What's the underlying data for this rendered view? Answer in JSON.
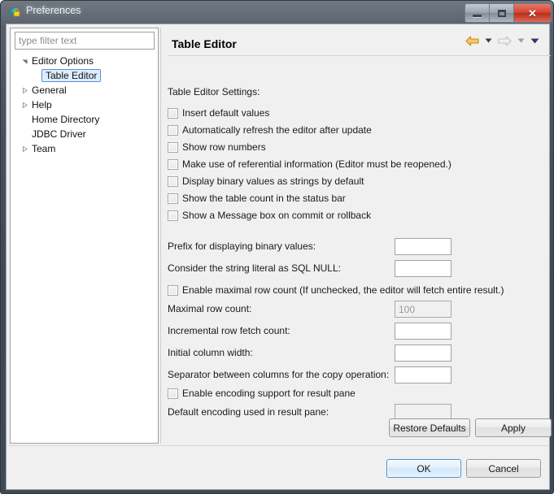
{
  "window": {
    "title": "Preferences",
    "icon": "preferences-lock-icon",
    "controls": {
      "minimize_label": "Minimize",
      "maximize_label": "Maximize",
      "close_label": "Close"
    },
    "colors": {
      "titlebar": "#49525e",
      "close_button": "#d1432f",
      "client_background": "#f0f0f0",
      "selection": "#ddeeff",
      "selection_border": "#5a8fd0",
      "default_button_border": "#3c93d6",
      "back_arrow": "#e8a33d",
      "forward_arrow_disabled": "#d8d8d8",
      "menu_caret": "#403a6b"
    }
  },
  "sidebar": {
    "filter": {
      "placeholder": "type filter text",
      "value": ""
    },
    "tree": [
      {
        "label": "Editor Options",
        "twisty": "expanded",
        "indent": 0,
        "selected": false
      },
      {
        "label": "Table Editor",
        "twisty": "none",
        "indent": 1,
        "selected": true
      },
      {
        "label": "General",
        "twisty": "collapsed",
        "indent": 0,
        "selected": false
      },
      {
        "label": "Help",
        "twisty": "collapsed",
        "indent": 0,
        "selected": false
      },
      {
        "label": "Home Directory",
        "twisty": "none",
        "indent": 0,
        "selected": false
      },
      {
        "label": "JDBC Driver",
        "twisty": "none",
        "indent": 0,
        "selected": false
      },
      {
        "label": "Team",
        "twisty": "collapsed",
        "indent": 0,
        "selected": false
      }
    ]
  },
  "content": {
    "title": "Table Editor",
    "nav": {
      "back_icon": "back-arrow-icon",
      "back_menu_icon": "chevron-down-icon",
      "forward_icon": "forward-arrow-icon",
      "forward_menu_icon": "chevron-down-icon",
      "view_menu_icon": "chevron-down-icon"
    },
    "section_label": "Table Editor Settings:",
    "checkboxes": [
      {
        "label": "Insert default values",
        "checked": false,
        "enabled": true
      },
      {
        "label": "Automatically refresh the editor after update",
        "checked": false,
        "enabled": true
      },
      {
        "label": "Show row numbers",
        "checked": false,
        "enabled": true
      },
      {
        "label": "Make use of referential information (Editor must be reopened.)",
        "checked": false,
        "enabled": true
      },
      {
        "label": "Display binary values as strings by default",
        "checked": false,
        "enabled": true
      },
      {
        "label": "Show the table count in the status bar",
        "checked": false,
        "enabled": true
      },
      {
        "label": "Show a Message box on commit or rollback",
        "checked": false,
        "enabled": true
      }
    ],
    "fields": [
      {
        "label": "Prefix for displaying binary values:",
        "value": "",
        "enabled": true
      },
      {
        "label": "Consider the string literal as SQL NULL:",
        "value": "",
        "enabled": true
      }
    ],
    "max_row_checkbox": {
      "label": "Enable maximal row count (If unchecked, the editor will fetch entire result.)",
      "checked": false
    },
    "fields2": [
      {
        "label": "Maximal row count:",
        "value": "100",
        "enabled": false
      },
      {
        "label": "Incremental row fetch count:",
        "value": "",
        "enabled": true
      },
      {
        "label": "Initial column width:",
        "value": "",
        "enabled": true
      },
      {
        "label": "Separator between columns for the copy operation:",
        "value": "",
        "enabled": true
      }
    ],
    "encoding_checkbox": {
      "label": "Enable encoding support for result pane",
      "checked": false
    },
    "encoding_field": {
      "label": "Default encoding used in result pane:",
      "value": "",
      "enabled": false
    }
  },
  "buttons": {
    "restore_defaults": "Restore Defaults",
    "apply": "Apply",
    "ok": "OK",
    "cancel": "Cancel"
  }
}
